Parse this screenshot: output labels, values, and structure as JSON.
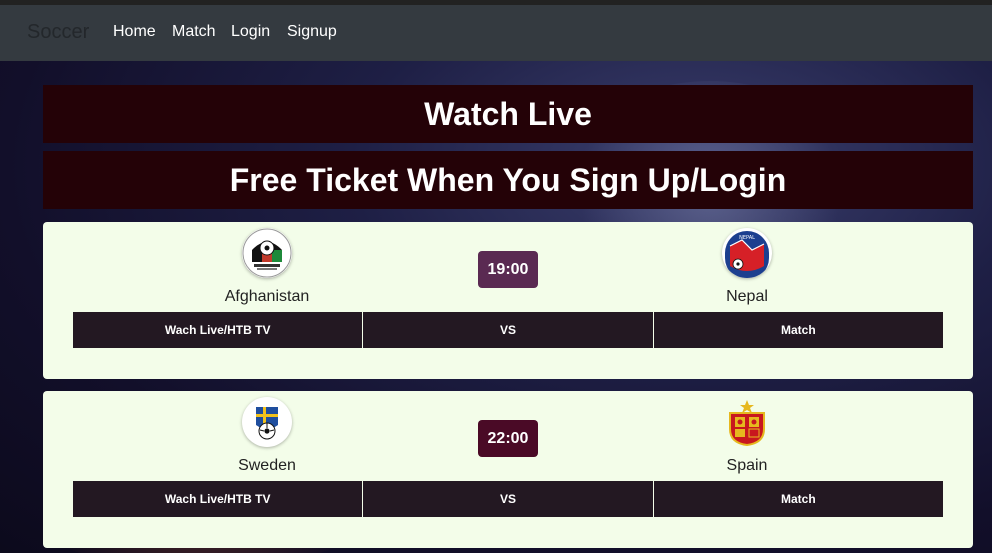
{
  "nav": {
    "brand": "Soccer",
    "links": [
      "Home",
      "Match",
      "Login",
      "Signup"
    ]
  },
  "banners": [
    "Watch Live",
    "Free Ticket When You Sign Up/Login"
  ],
  "matches": [
    {
      "home": "Afghanistan",
      "away": "Nepal",
      "time": "19:00",
      "time_color": "#5a2a52",
      "row": [
        "Wach Live/HTB TV",
        "VS",
        "Match"
      ],
      "home_icon": "afghanistan-football-crest-icon",
      "away_icon": "nepal-football-crest-icon"
    },
    {
      "home": "Sweden",
      "away": "Spain",
      "time": "22:00",
      "time_color": "#4a0a26",
      "row": [
        "Wach Live/HTB TV",
        "VS",
        "Match"
      ],
      "home_icon": "sweden-football-crest-icon",
      "away_icon": "spain-football-crest-icon"
    }
  ],
  "colors": {
    "navbar": "#343a40",
    "banner": "#240207",
    "card": "#f3fde9",
    "row_cell": "#231822"
  }
}
